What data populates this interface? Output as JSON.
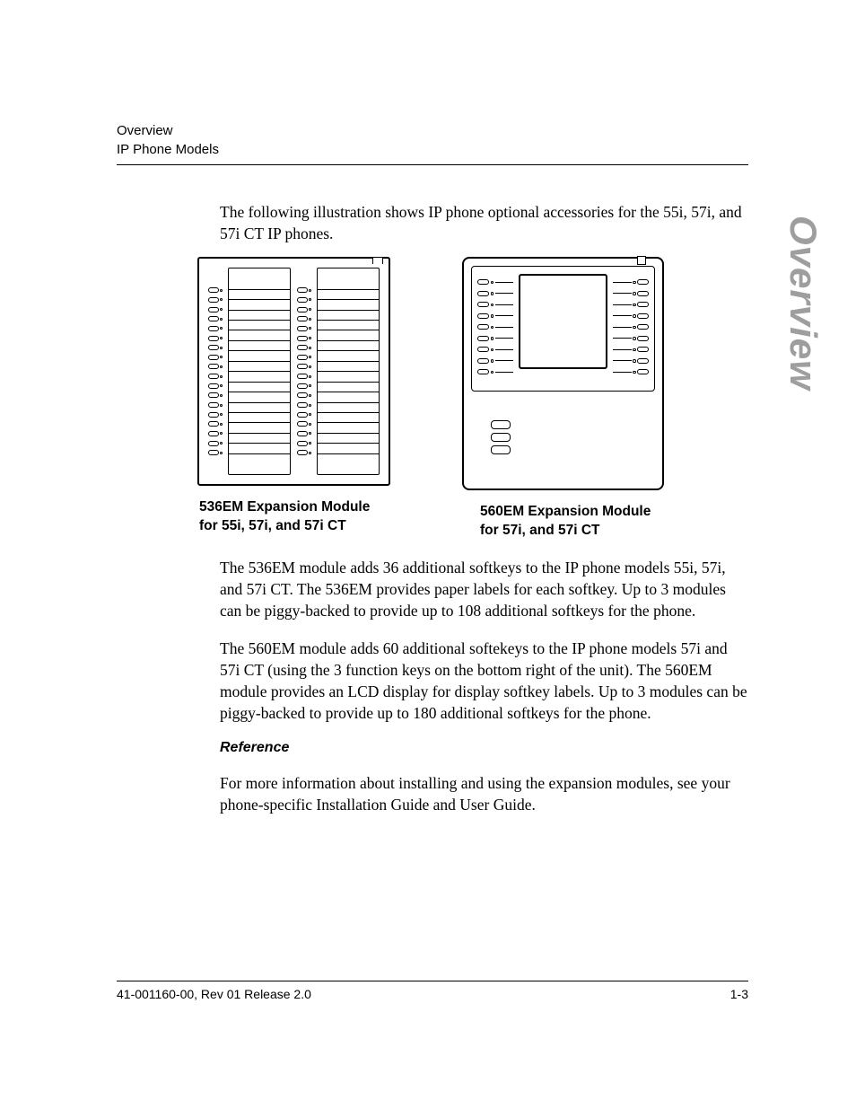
{
  "header": {
    "line1": "Overview",
    "line2": "IP Phone Models"
  },
  "side_tab": "Overview",
  "body": {
    "intro": "The following illustration shows IP phone optional accessories for the 55i, 57i, and 57i CT IP phones.",
    "caption_536_line1": "536EM Expansion Module",
    "caption_536_line2": "for 55i, 57i, and 57i CT",
    "caption_560_line1": "560EM Expansion Module",
    "caption_560_line2": "for 57i, and 57i CT",
    "para_536": "The 536EM module adds 36 additional softkeys to the IP phone models 55i, 57i, and 57i CT. The 536EM provides paper labels for each softkey. Up to 3 modules can be piggy-backed to provide up to 108 additional softkeys for the phone.",
    "para_560": "The 560EM module adds 60 additional softekeys to the IP phone models 57i and 57i CT (using the 3 function keys on the bottom right of the unit). The 560EM module provides an LCD display for display softkey labels. Up to 3 modules can be piggy-backed to provide up to 180 additional softkeys for the phone.",
    "reference_heading": "Reference",
    "reference_text": "For more information about installing and using the expansion modules, see your phone-specific Installation Guide and User Guide."
  },
  "footer": {
    "left": "41-001160-00, Rev 01 Release 2.0",
    "right": "1-3"
  }
}
